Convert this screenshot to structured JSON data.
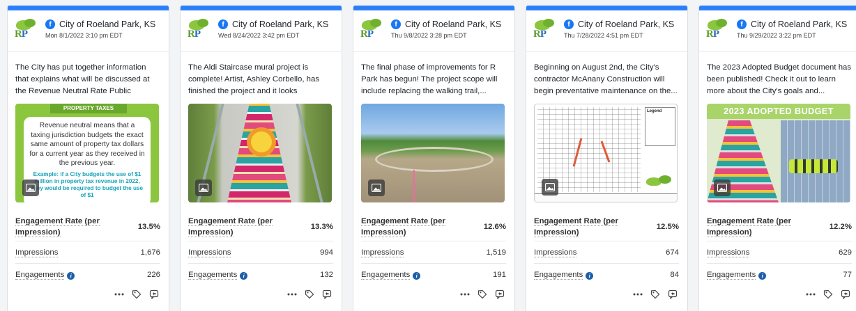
{
  "account": "City of Roeland Park, KS",
  "labels": {
    "engagement_rate": "Engagement Rate (per Impression)",
    "impressions": "Impressions",
    "engagements": "Engagements"
  },
  "icons": {
    "network": "facebook-icon",
    "media": "image-icon",
    "more": "more-icon",
    "tag": "tag-icon",
    "reply": "reply-icon",
    "info": "info-icon"
  },
  "colors": {
    "accent": "#2d7ff9",
    "facebook": "#1877f2"
  },
  "posts": [
    {
      "date": "Mon 8/1/2022 3:10 pm EDT",
      "text": "The City has put together information that explains what will be discussed at the Revenue Neutral Rate Public Hearing...",
      "engagement_rate": "13.5%",
      "impressions": "1,676",
      "engagements": "226",
      "image": {
        "heading": "PROPERTY TAXES",
        "body": "Revenue neutral means that a taxing jurisdiction budgets the exact same amount of property tax dollars for a current year as they received in the previous year.",
        "example": "Example: if a City budgets the use of $1 million in property tax revenue in 2022, they would be required to budget the use of $1"
      }
    },
    {
      "date": "Wed 8/24/2022 3:42 pm EDT",
      "text": "The Aldi Staircase mural project is complete! Artist, Ashley Corbello, has finished the project and it looks absolute...",
      "engagement_rate": "13.3%",
      "impressions": "994",
      "engagements": "132"
    },
    {
      "date": "Thu 9/8/2022 3:28 pm EDT",
      "text": "The final phase of improvements for R Park has begun! The project scope will include replacing the walking trail,...",
      "engagement_rate": "12.6%",
      "impressions": "1,519",
      "engagements": "191"
    },
    {
      "date": "Thu 7/28/2022 4:51 pm EDT",
      "text": "Beginning on August 2nd, the City's contractor McAnany Construction will begin preventative maintenance on the...",
      "engagement_rate": "12.5%",
      "impressions": "674",
      "engagements": "84",
      "image": {
        "legend": "Legend"
      }
    },
    {
      "date": "Thu 9/29/2022 3:22 pm EDT",
      "text": "The 2023 Adopted Budget document has been published! Check it out to learn more about the City's goals and...",
      "engagement_rate": "12.2%",
      "impressions": "629",
      "engagements": "77",
      "image": {
        "banner": "2023 ADOPTED BUDGET"
      }
    }
  ]
}
